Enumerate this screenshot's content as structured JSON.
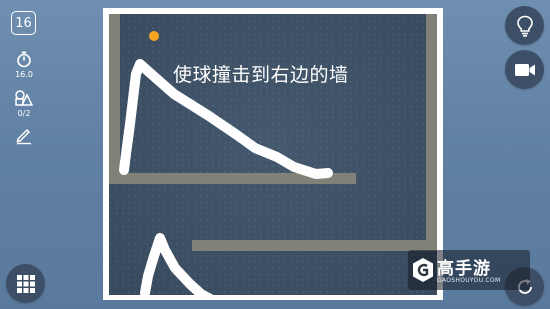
{
  "level": {
    "number": "16"
  },
  "stats": {
    "timer": {
      "icon": "stopwatch-icon",
      "value": "16.0"
    },
    "shapes": {
      "icon": "shapes-icon",
      "value": "0/2"
    },
    "pen": {
      "icon": "pencil-icon"
    }
  },
  "board": {
    "instruction": "使球撞击到右边的墙",
    "ball_color": "#f5a623",
    "wall_color": "#818177",
    "background_color": "#3b4e63"
  },
  "buttons": {
    "hint": {
      "icon": "lightbulb-icon"
    },
    "video": {
      "icon": "video-camera-icon"
    },
    "menu": {
      "icon": "grid-menu-icon"
    },
    "reset": {
      "icon": "reset-icon"
    }
  },
  "watermark": {
    "name": "高手游",
    "url": "GAOSHOUYOU.COM"
  }
}
